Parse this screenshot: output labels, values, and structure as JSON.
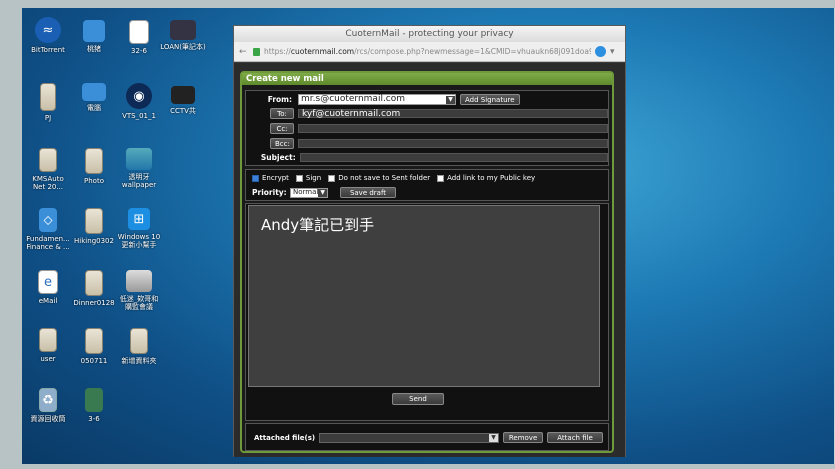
{
  "desktop": {
    "icons": [
      {
        "label": "BitTorrent",
        "icon": "bittorrent-icon"
      },
      {
        "label": "桃猪",
        "icon": "folder-icon"
      },
      {
        "label": "32-6",
        "icon": "document-icon"
      },
      {
        "label": "LOAN(筆記本)",
        "icon": "app-icon"
      },
      {
        "label": "PJ",
        "icon": "folder-icon"
      },
      {
        "label": "電腦",
        "icon": "computer-icon"
      },
      {
        "label": "VTS_01_1",
        "icon": "media-icon"
      },
      {
        "label": "CCTV共",
        "icon": "app-icon"
      },
      {
        "label": "KMSAuto\nNet 20...",
        "icon": "document-icon"
      },
      {
        "label": "Photo",
        "icon": "folder-icon"
      },
      {
        "label": "透明牙\nwallpaper",
        "icon": "image-icon"
      },
      {
        "label": "Fundamen...\nFinance & ...",
        "icon": "document-icon"
      },
      {
        "label": "Hiking0302",
        "icon": "folder-icon"
      },
      {
        "label": "Windows 10\n更新小幫手",
        "icon": "windows-icon"
      },
      {
        "label": "eMail",
        "icon": "document-icon"
      },
      {
        "label": "Dinner0128",
        "icon": "folder-icon"
      },
      {
        "label": "低迷_欸哥和\n購監會議",
        "icon": "image-icon"
      },
      {
        "label": "user",
        "icon": "user-icon"
      },
      {
        "label": "050711",
        "icon": "folder-icon"
      },
      {
        "label": "新增資料夾",
        "icon": "folder-icon"
      },
      {
        "label": "資源回收筒",
        "icon": "recycle-bin-icon"
      },
      {
        "label": "3-6",
        "icon": "document-icon"
      }
    ]
  },
  "browser": {
    "title": "CuoternMail - protecting your privacy",
    "url_prefix": "https://",
    "url_domain": "cuoternmail.com",
    "url_rest": "/rcs/compose.php?newmessage=1&CMID=vhuaukn68j091doa900ca"
  },
  "compose": {
    "title": "Create new mail",
    "from_label": "From:",
    "from_value": "mr.s@cuoternmail.com",
    "add_signature": "Add Signature",
    "to_button": "To:",
    "to_value": "kyf@cuoternmail.com",
    "cc_button": "Cc:",
    "cc_value": "",
    "bcc_button": "Bcc:",
    "bcc_value": "",
    "subject_label": "Subject:",
    "subject_value": "",
    "encrypt_label": "Encrypt",
    "encrypt_checked": true,
    "sign_label": "Sign",
    "no_save_label": "Do not save to Sent folder",
    "public_key_label": "Add link to my Public key",
    "priority_label": "Priority:",
    "priority_value": "Normal",
    "save_draft": "Save draft",
    "body_text": "Andy筆記已到手",
    "send": "Send",
    "attached_label": "Attached file(s)",
    "remove": "Remove",
    "attach_file": "Attach file"
  }
}
